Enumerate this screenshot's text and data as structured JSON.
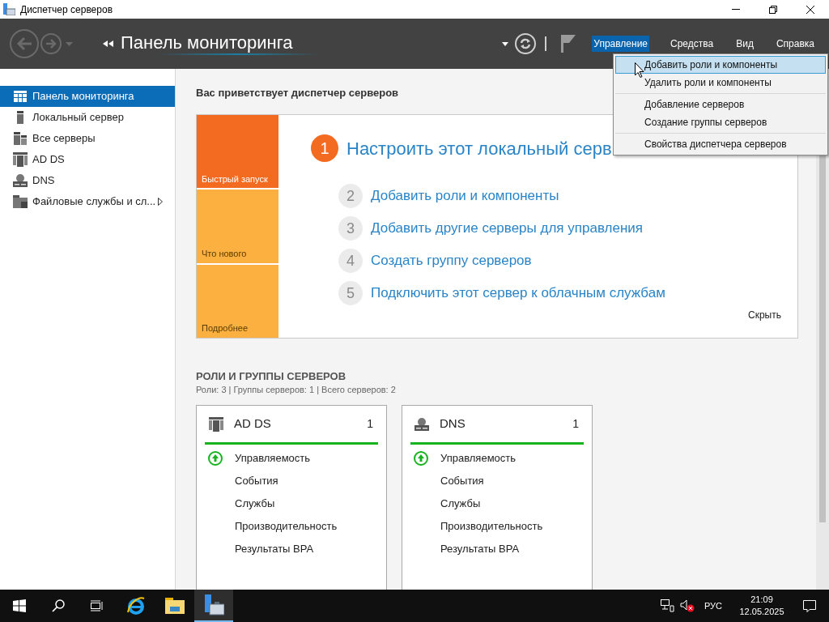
{
  "window": {
    "title": "Диспетчер серверов"
  },
  "header": {
    "title": "Панель мониторинга",
    "menu": [
      {
        "label": "Управление",
        "selected": true
      },
      {
        "label": "Средства",
        "selected": false
      },
      {
        "label": "Вид",
        "selected": false
      },
      {
        "label": "Справка",
        "selected": false
      }
    ]
  },
  "dropdown": {
    "groups": [
      [
        {
          "label": "Добавить роли и компоненты",
          "selected": true
        },
        {
          "label": "Удалить роли и компоненты",
          "selected": false
        }
      ],
      [
        {
          "label": "Добавление серверов",
          "selected": false
        },
        {
          "label": "Создание группы серверов",
          "selected": false
        }
      ],
      [
        {
          "label": "Свойства диспетчера серверов",
          "selected": false
        }
      ]
    ]
  },
  "sidebar": {
    "items": [
      {
        "label": "Панель мониторинга",
        "kind": "dashboard",
        "selected": true,
        "expandable": false
      },
      {
        "label": "Локальный сервер",
        "kind": "server",
        "selected": false,
        "expandable": false
      },
      {
        "label": "Все серверы",
        "kind": "servers",
        "selected": false,
        "expandable": false
      },
      {
        "label": "AD DS",
        "kind": "adds",
        "selected": false,
        "expandable": false
      },
      {
        "label": "DNS",
        "kind": "dns",
        "selected": false,
        "expandable": false
      },
      {
        "label": "Файловые службы и сл...",
        "kind": "files",
        "selected": false,
        "expandable": true
      }
    ]
  },
  "welcome": {
    "title": "Вас приветствует диспетчер серверов",
    "tiles": [
      {
        "label": "Быстрый запуск",
        "selected": true
      },
      {
        "label": "Что нового",
        "selected": false
      },
      {
        "label": "Подробнее",
        "selected": false
      }
    ],
    "steps": [
      {
        "number": "1",
        "label": "Настроить этот локальный серв",
        "selected": true
      },
      {
        "number": "2",
        "label": "Добавить роли и компоненты",
        "selected": false
      },
      {
        "number": "3",
        "label": "Добавить другие серверы для управления",
        "selected": false
      },
      {
        "number": "4",
        "label": "Создать группу серверов",
        "selected": false
      },
      {
        "number": "5",
        "label": "Подключить этот сервер к облачным службам",
        "selected": false
      }
    ],
    "hide": "Скрыть"
  },
  "roles": {
    "title": "РОЛИ И ГРУППЫ СЕРВЕРОВ",
    "summary": "Роли: 3 | Группы серверов: 1 | Всего серверов: 2",
    "cards": [
      {
        "name": "AD DS",
        "kind": "adds",
        "count": "1",
        "rows": [
          {
            "label": "Управляемость",
            "ok": true
          },
          {
            "label": "События",
            "ok": false
          },
          {
            "label": "Службы",
            "ok": false
          },
          {
            "label": "Производительность",
            "ok": false
          },
          {
            "label": "Результаты BPA",
            "ok": false
          }
        ]
      },
      {
        "name": "DNS",
        "kind": "dns",
        "count": "1",
        "rows": [
          {
            "label": "Управляемость",
            "ok": true
          },
          {
            "label": "События",
            "ok": false
          },
          {
            "label": "Службы",
            "ok": false
          },
          {
            "label": "Производительность",
            "ok": false
          },
          {
            "label": "Результаты BPA",
            "ok": false
          }
        ]
      }
    ]
  },
  "taskbar": {
    "apps": [
      {
        "kind": "ie",
        "selected": false
      },
      {
        "kind": "explorer",
        "selected": false
      },
      {
        "kind": "servermanager",
        "selected": true
      }
    ],
    "language": "РУС",
    "time": "21:09",
    "date": "12.05.2025"
  }
}
